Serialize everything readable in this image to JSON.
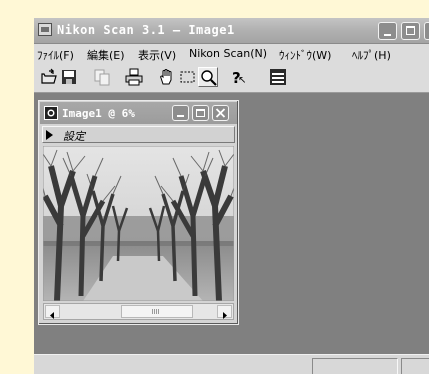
{
  "window": {
    "title": "Nikon Scan 3.1 – Image1"
  },
  "menu": [
    {
      "label": "ﾌｧｲﾙ(F)"
    },
    {
      "label": "編集(E)"
    },
    {
      "label": "表示(V)"
    },
    {
      "label": "Nikon Scan(N)"
    },
    {
      "label": "ｳｨﾝﾄﾞｳ(W)"
    },
    {
      "label": "ﾍﾙﾌﾟ(H)"
    }
  ],
  "toolbar": {
    "buttons": [
      {
        "icon": "open-folder-icon"
      },
      {
        "icon": "save-disk-icon"
      },
      {
        "icon": "copy-icon"
      },
      {
        "icon": "print-icon"
      },
      {
        "icon": "hand-tool-icon"
      },
      {
        "icon": "marquee-select-icon"
      },
      {
        "icon": "zoom-icon",
        "pressed": true
      },
      {
        "icon": "help-icon"
      },
      {
        "icon": "tool-palette-icon"
      }
    ]
  },
  "image_window": {
    "title": "Image1 @ 6%",
    "settings_label": "設定"
  },
  "colors": {
    "background": "#fff8d6",
    "workspace": "#808080",
    "title_bar": "#b0b0b0",
    "chrome": "#dcdcdc"
  }
}
